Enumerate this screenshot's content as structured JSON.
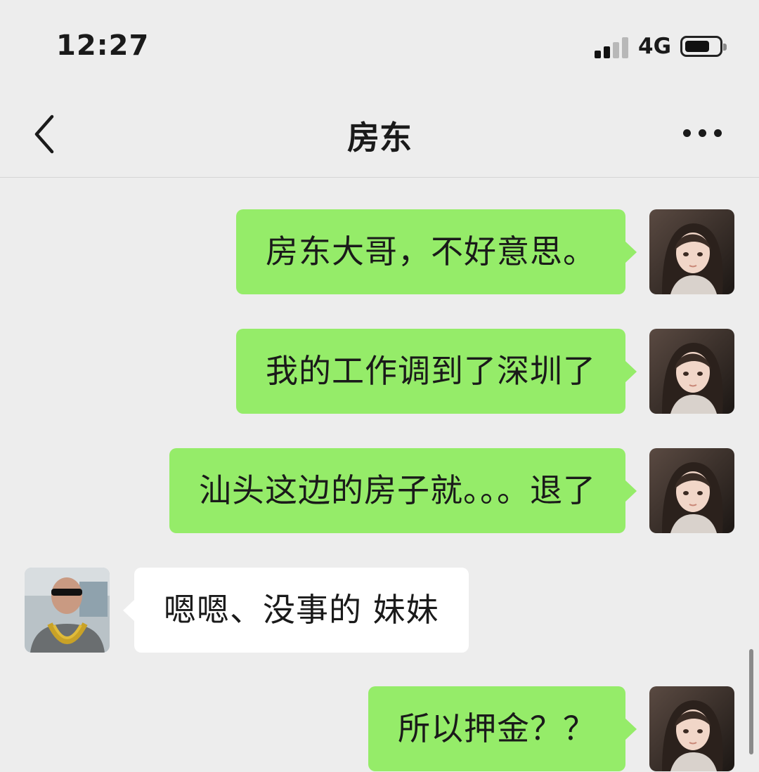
{
  "status_bar": {
    "time": "12:27",
    "network": "4G",
    "signal_bars_filled": 2,
    "signal_bars_total": 4,
    "battery_level": 0.7
  },
  "nav": {
    "title": "房东",
    "back_icon": "chevron-left-icon",
    "more_icon": "more-dots-icon"
  },
  "messages": [
    {
      "from": "me",
      "text": "房东大哥，不好意思。"
    },
    {
      "from": "me",
      "text": "我的工作调到了深圳了"
    },
    {
      "from": "me",
      "text": "汕头这边的房子就。。。退了"
    },
    {
      "from": "other",
      "text": "嗯嗯、没事的 妹妹"
    },
    {
      "from": "me",
      "text": "所以押金？？"
    }
  ],
  "colors": {
    "background": "#ededed",
    "outgoing_bubble": "#95ec69",
    "incoming_bubble": "#ffffff",
    "text": "#1a1a1a"
  }
}
